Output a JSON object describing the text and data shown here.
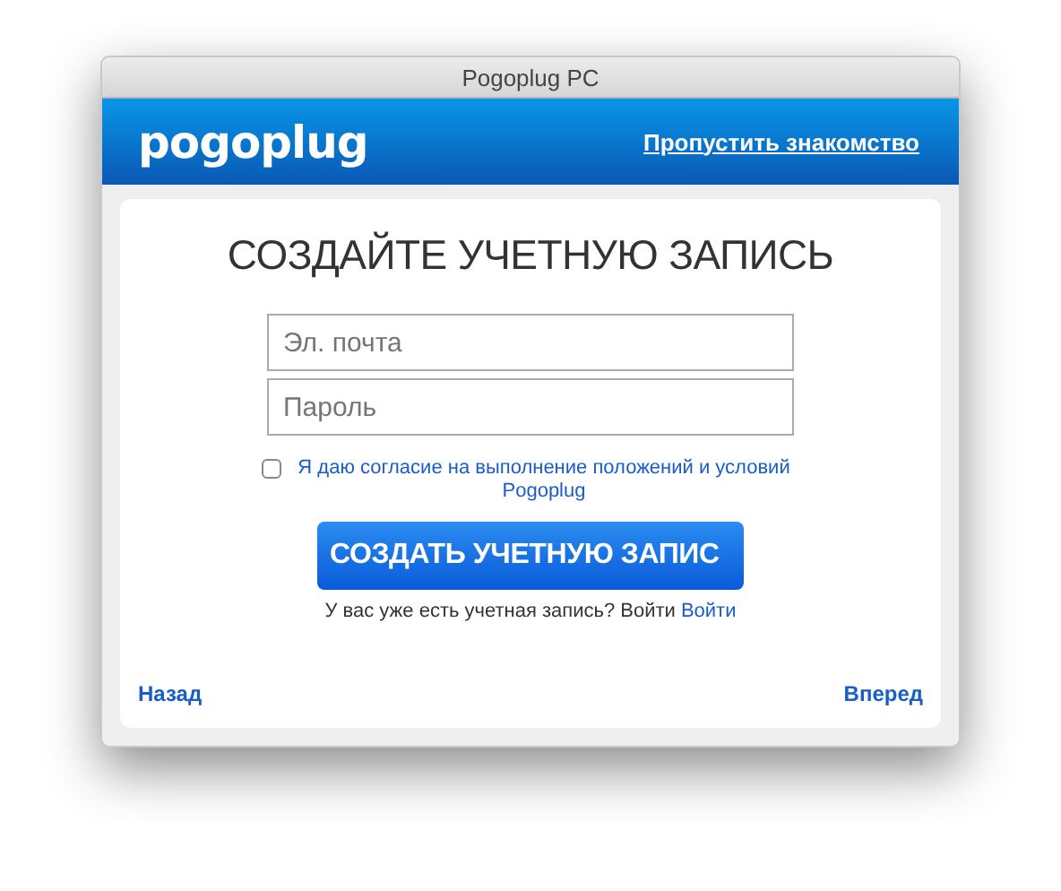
{
  "window": {
    "title": "Pogoplug PC"
  },
  "header": {
    "logo": "pogoplug",
    "skip_link": "Пропустить знакомство"
  },
  "form": {
    "heading": "СОЗДАЙТЕ УЧЕТНУЮ ЗАПИСЬ",
    "fields": [
      {
        "placeholder": "Эл. почта"
      },
      {
        "placeholder": "Пароль"
      }
    ],
    "agreement": {
      "checked": false,
      "label": "Я даю согласие на выполнение положений и условий Pogoplug"
    },
    "submit": "СОЗДАТЬ УЧЕТНУЮ ЗАПИС",
    "login_prompt": "У вас уже есть учетная запись? Войти",
    "login_link": "Войти"
  },
  "nav": {
    "back": "Назад",
    "next": "Вперед"
  }
}
